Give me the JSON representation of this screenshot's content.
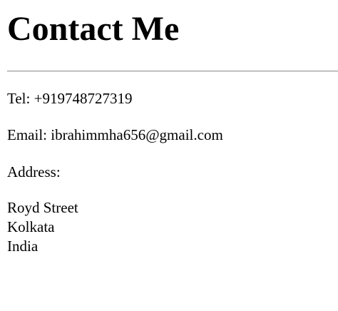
{
  "heading": "Contact Me",
  "contact": {
    "tel": "Tel: +919748727319",
    "email": "Email: ibrahimmha656@gmail.com",
    "address_label": "Address:",
    "address_lines": [
      "Royd Street",
      "Kolkata",
      "India"
    ]
  }
}
